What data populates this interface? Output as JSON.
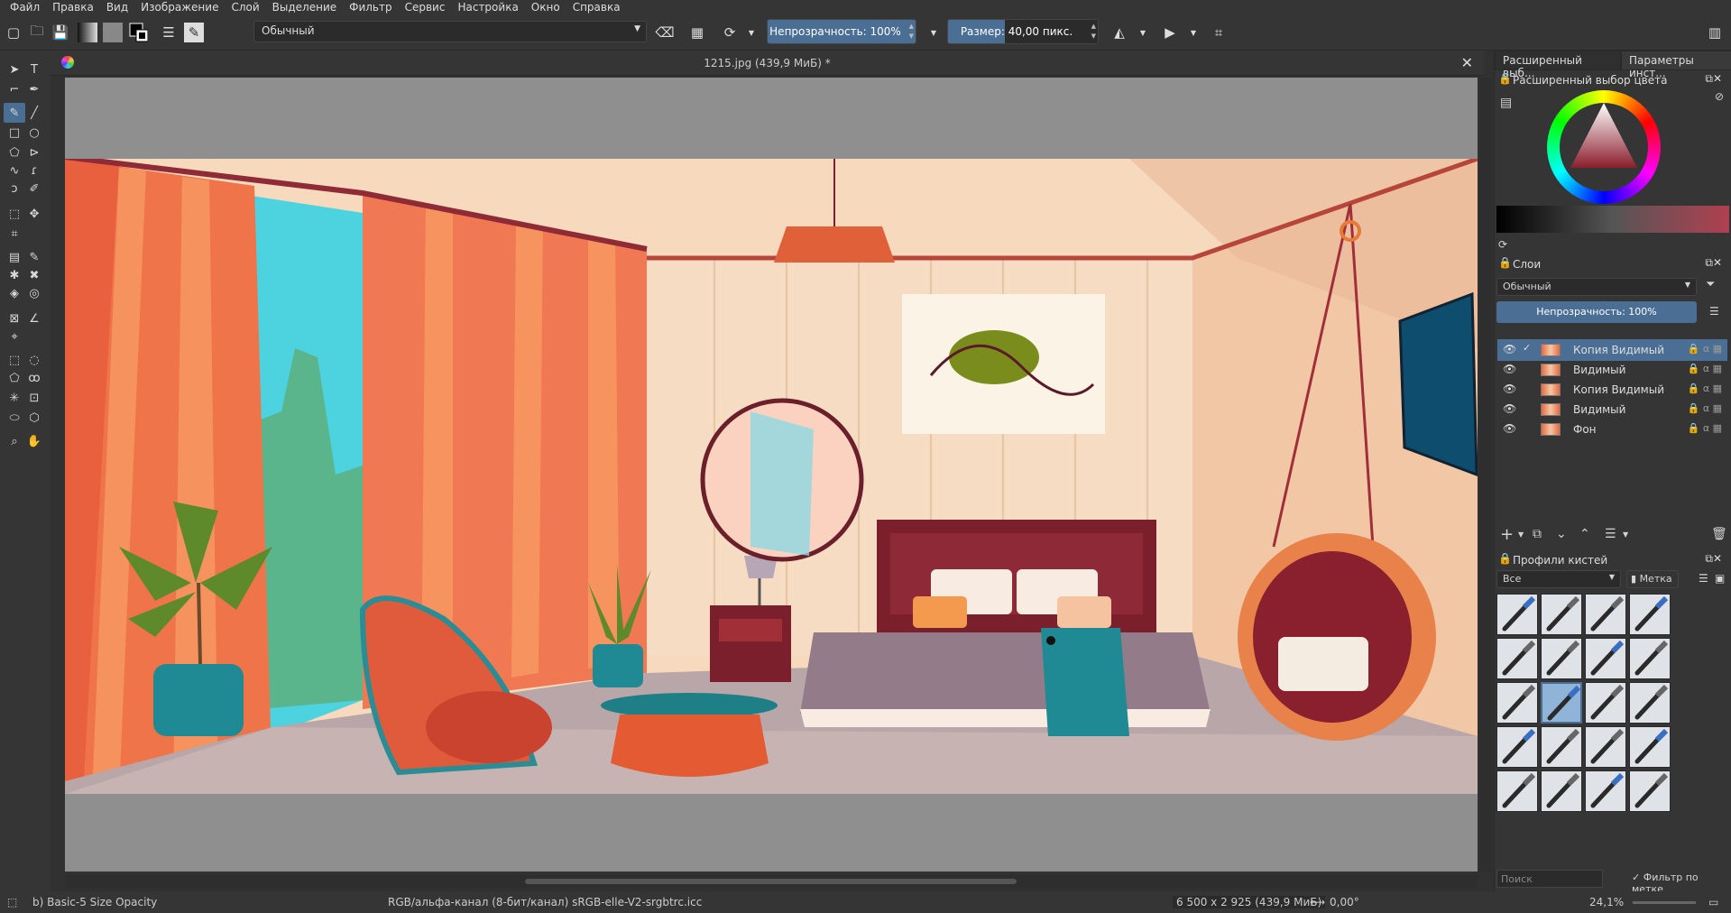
{
  "menu": [
    "Файл",
    "Правка",
    "Вид",
    "Изображение",
    "Слой",
    "Выделение",
    "Фильтр",
    "Сервис",
    "Настройка",
    "Окно",
    "Справка"
  ],
  "toolbar": {
    "blend_mode": "Обычный",
    "opacity_label": "Непрозрачность: 100%",
    "opacity_value": 1.0,
    "size_label": "Размер: 40,00 пикс.",
    "size_value": 0.38
  },
  "document": {
    "title": "1215.jpg (439,9 МиБ) *"
  },
  "dock": {
    "tabs": [
      "Расширенный выб...",
      "Параметры инст..."
    ],
    "color_panel_title": "Расширенный выбор цвета",
    "layers_panel_title": "Слои",
    "layers_blend": "Обычный",
    "layers_opacity": "Непрозрачность:  100%",
    "layers": [
      {
        "name": "Копия Видимый",
        "selected": true,
        "checked": true
      },
      {
        "name": "Видимый",
        "selected": false,
        "checked": false
      },
      {
        "name": "Копия Видимый",
        "selected": false,
        "checked": false
      },
      {
        "name": "Видимый",
        "selected": false,
        "checked": false
      },
      {
        "name": "Фон",
        "selected": false,
        "checked": false
      }
    ],
    "brush_panel_title": "Профили кистей",
    "brush_filter": "Все",
    "brush_tag_button": "Метка",
    "search_placeholder": "Поиск",
    "filter_by_tag": "Фильтр по метке"
  },
  "status": {
    "preset": "b) Basic-5 Size Opacity",
    "colorspace": "RGB/альфа-канал (8-бит/канал)  sRGB-elle-V2-srgbtrc.icc",
    "dimensions": "6 500 x 2 925 (439,9 МиБ)",
    "rotation": "0,00°",
    "zoom": "24,1%"
  },
  "colors": {
    "accent": "#4b6e95",
    "panel": "#353535",
    "canvas_bg": "#8f8f8f"
  }
}
